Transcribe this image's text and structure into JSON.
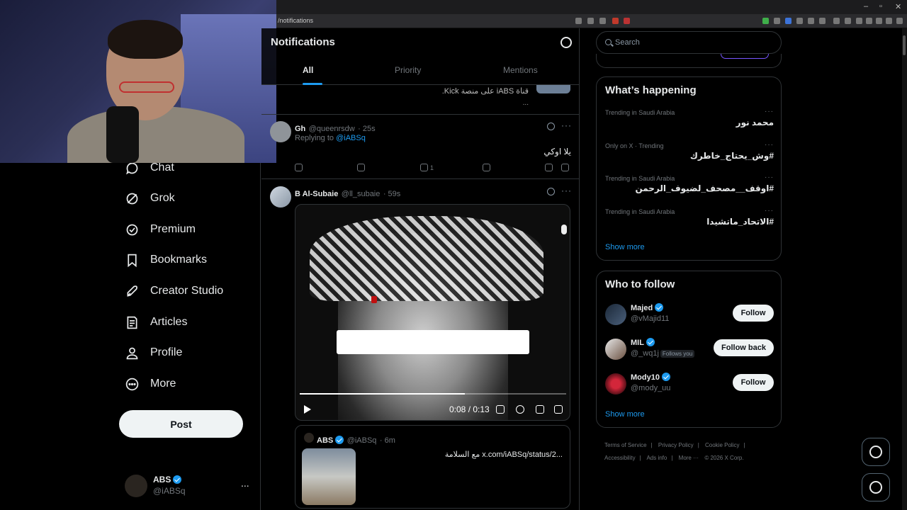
{
  "browser": {
    "url": "/notifications",
    "window_controls": [
      "–",
      "▫",
      "✕"
    ]
  },
  "nav": {
    "items": [
      {
        "label": "Chat",
        "icon": "chat-icon"
      },
      {
        "label": "Grok",
        "icon": "grok-icon"
      },
      {
        "label": "Premium",
        "icon": "premium-icon"
      },
      {
        "label": "Bookmarks",
        "icon": "bookmark-icon"
      },
      {
        "label": "Creator Studio",
        "icon": "rocket-icon"
      },
      {
        "label": "Articles",
        "icon": "article-icon"
      },
      {
        "label": "Profile",
        "icon": "profile-icon"
      },
      {
        "label": "More",
        "icon": "more-circle-icon"
      }
    ],
    "post_label": "Post",
    "account": {
      "name": "ABS",
      "handle": "@iABSq",
      "more": "..."
    }
  },
  "header": {
    "title": "Notifications",
    "tabs": [
      "All",
      "Priority",
      "Mentions"
    ],
    "active_tab": "All"
  },
  "feed": {
    "previous": {
      "line1": "قناة iABS على منصة Kick.",
      "line2": "..."
    },
    "reply_tweet": {
      "name": "Gh",
      "handle": "@queenrsdw",
      "time": "· 25s",
      "replying_to_prefix": "Replying to",
      "replying_to": "@iABSq",
      "text": "يلا اوكي",
      "likes": "1"
    },
    "video_tweet": {
      "name": "B Al-Subaie",
      "handle": "@ll_subaie",
      "time": "· 59s",
      "video": {
        "time": "0:08 / 0:13",
        "progress": 0.62
      },
      "quote": {
        "name": "ABS",
        "handle": "@iABSq",
        "time": "· 6m",
        "text": "مع السلامة  x.com/iABSq/status/2..."
      }
    }
  },
  "sidebar": {
    "search_placeholder": "Search",
    "trends_title": "What’s happening",
    "trends": [
      {
        "context": "Trending in Saudi Arabia",
        "name": "محمد نور"
      },
      {
        "context": "Only on X · Trending",
        "name": "#وش_يحتاج_خاطرك"
      },
      {
        "context": "Trending in Saudi Arabia",
        "name": "#اوقف__مصحف_لضيوف_الرحمن"
      },
      {
        "context": "Trending in Saudi Arabia",
        "name": "#الاتحاد_ماتشيدا"
      }
    ],
    "show_more": "Show more",
    "follow_title": "Who to follow",
    "follow": [
      {
        "name": "Majed",
        "handle": "@vMajid11",
        "button": "Follow",
        "follows_you": ""
      },
      {
        "name": "MIL",
        "handle": "@_wq1j",
        "button": "Follow back",
        "follows_you": "Follows you"
      },
      {
        "name": "Mody10",
        "handle": "@mody_uu",
        "button": "Follow",
        "follows_you": ""
      }
    ],
    "footer": [
      "Terms of Service",
      "|",
      "Privacy Policy",
      "|",
      "Cookie Policy",
      "|",
      "Accessibility",
      "|",
      "Ads info",
      "|",
      "More ···",
      "© 2026 X Corp."
    ]
  }
}
